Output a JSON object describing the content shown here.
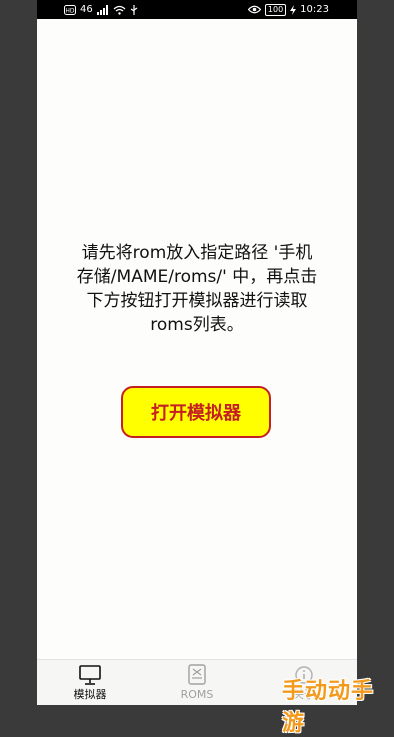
{
  "status_bar": {
    "signal_label": "46",
    "time": "10:23",
    "battery": "100"
  },
  "main": {
    "instructions": "请先将rom放入指定路径 '手机\n存储/MAME/roms/' 中，再点击\n下方按钮打开模拟器进行读取\nroms列表。",
    "open_button_label": "打开模拟器"
  },
  "tabs": [
    {
      "label": "模拟器",
      "icon": "monitor-icon"
    },
    {
      "label": "ROMS",
      "icon": "rom-cartridge-icon"
    },
    {
      "label": "关于",
      "icon": "info-icon"
    }
  ],
  "watermark": "手动动手游",
  "colors": {
    "button_fill": "#ffff00",
    "button_text": "#c41f22",
    "button_border": "#c41f22",
    "watermark": "#f39a1d"
  }
}
